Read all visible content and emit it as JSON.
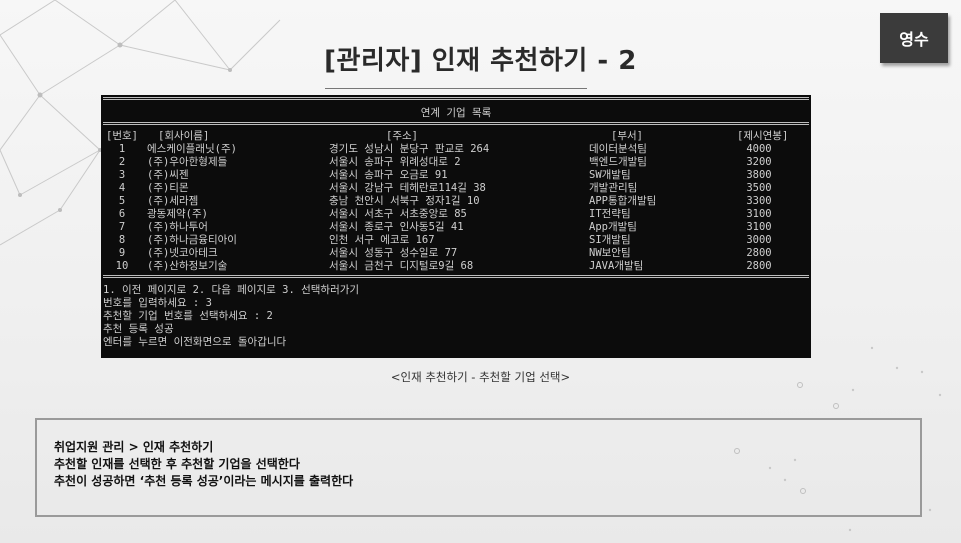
{
  "slide": {
    "title": "[관리자] 인재 추천하기 - 2",
    "badge": "영수",
    "caption": "<인재 추천하기 - 추천할 기업 선택>"
  },
  "terminal": {
    "heading": "연계 기업 목록",
    "columns": [
      "[번호]",
      "[회사이름]",
      "[주소]",
      "[부서]",
      "[제시연봉]"
    ],
    "rows": [
      {
        "no": "1",
        "name": "에스케이플래닛(주)",
        "addr": "경기도 성남시 분당구 판교로 264",
        "dept": "데이터분석팀",
        "salary": "4000"
      },
      {
        "no": "2",
        "name": "(주)우아한형제들",
        "addr": "서울시 송파구 위례성대로 2",
        "dept": "백엔드개발팀",
        "salary": "3200"
      },
      {
        "no": "3",
        "name": "(주)씨젠",
        "addr": "서울시 송파구 오금로 91",
        "dept": "SW개발팀",
        "salary": "3800"
      },
      {
        "no": "4",
        "name": "(주)티몬",
        "addr": "서울시 강남구 테헤란로114길 38",
        "dept": "개발관리팀",
        "salary": "3500"
      },
      {
        "no": "5",
        "name": "(주)세라젬",
        "addr": "충남 천안시 서북구 정자1길 10",
        "dept": "APP통합개발팀",
        "salary": "3300"
      },
      {
        "no": "6",
        "name": "광동제약(주)",
        "addr": "서울시 서초구 서초중앙로 85",
        "dept": "IT전략팀",
        "salary": "3100"
      },
      {
        "no": "7",
        "name": "(주)하나투어",
        "addr": "서울시 종로구 인사동5길 41",
        "dept": "App개발팀",
        "salary": "3100"
      },
      {
        "no": "8",
        "name": "(주)하나금융티아이",
        "addr": "인천 서구 에코로 167",
        "dept": "SI개발팀",
        "salary": "3000"
      },
      {
        "no": "9",
        "name": "(주)넷코아테크",
        "addr": "서울시 성동구 성수일로 77",
        "dept": "NW보안팀",
        "salary": "2800"
      },
      {
        "no": "10",
        "name": "(주)산하정보기술",
        "addr": "서울시 금천구 디지털로9길 68",
        "dept": "JAVA개발팀",
        "salary": "2800"
      }
    ],
    "menu": "1. 이전 페이지로 2. 다음 페이지로 3. 선택하러가기",
    "prompt1": "번호를 입력하세요 : 3",
    "prompt2": "추천할 기업 번호를 선택하세요 : 2",
    "result": "추천 등록 성공",
    "enter": "엔터를 누르면 이전화면으로 돌아갑니다"
  },
  "description": {
    "line1": "취업지원 관리 > 인재 추천하기",
    "line2": "추천할 인재를 선택한 후 추천할 기업을 선택한다",
    "line3": "추천이 성공하면 ‘추천 등록 성공’이라는 메시지를 출력한다"
  }
}
